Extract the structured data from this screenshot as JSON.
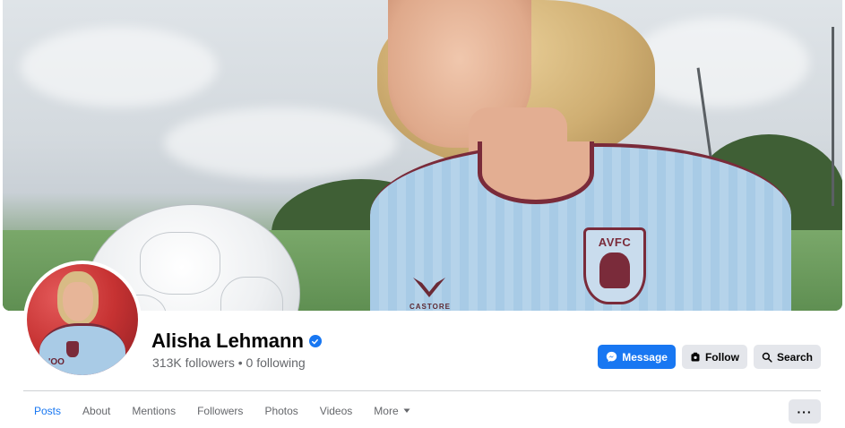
{
  "profile": {
    "name": "Alisha Lehmann",
    "verified": true,
    "followers_text": "313K followers",
    "separator": " • ",
    "following_text": "0 following"
  },
  "cover": {
    "crest_text": "AVFC",
    "kit_brand": "CASTORE"
  },
  "avatar": {
    "shirt_text": "'OO"
  },
  "actions": {
    "message_label": "Message",
    "follow_label": "Follow",
    "search_label": "Search"
  },
  "tabs": [
    {
      "label": "Posts",
      "active": true
    },
    {
      "label": "About",
      "active": false
    },
    {
      "label": "Mentions",
      "active": false
    },
    {
      "label": "Followers",
      "active": false
    },
    {
      "label": "Photos",
      "active": false
    },
    {
      "label": "Videos",
      "active": false
    },
    {
      "label": "More",
      "active": false
    }
  ],
  "more_menu": {
    "label": "···"
  },
  "colors": {
    "accent": "#1877f2",
    "secondary_button": "#e4e6eb",
    "muted_text": "#65676b"
  },
  "icons": {
    "message": "messenger-icon",
    "follow": "follow-icon",
    "search": "search-icon",
    "verified": "verified-badge-icon",
    "more_caret": "caret-down-icon"
  }
}
